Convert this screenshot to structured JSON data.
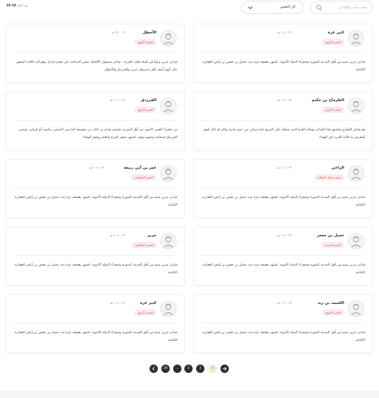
{
  "toolbar": {
    "search_placeholder": "ابحث باسم الشاعر...",
    "filter_value": "كل العصور",
    "count_prefix": "من أصل",
    "count_shown": "10",
    "count_total": "18"
  },
  "cards": [
    {
      "name": "كثير عزة",
      "dates": "٢٣ - ١٠٥ هـ",
      "era": "العصر الأموي",
      "avatar": "poet-portrait-icon",
      "bio": "شاعر عربي متيم من أهل المدينة المنورة وشعراء الدولة الأموية، اشتهر بعشقه عزة بنت جميل بن حفص بن إياس الغفارية الكنانية."
    },
    {
      "name": "الأخطل",
      "dates": "١٩ - ٩٢ هـ",
      "era": "العصر الأموي",
      "avatar": "poet-portrait-icon",
      "bio": "شاعر عربي ونشأ في قبيلة تغلب العربية ، شاعر مصقول الألفاظ، حسن الديباجة، في شعره إبداع. وهو أحد الثلاثة المتفق على أنهم أشعر أهل عصرهم: جرير والفرزدق والأخطل."
    },
    {
      "name": "الطرماح بن حكيم",
      "dates": "٢٣ - ١٠٥ هـ",
      "era": "العصر الأموي",
      "avatar": "poet-portrait-icon",
      "bio": "هو شاعر الخوارج واشتهر هذا الشاعر بهجائه الفذع الذي سلطه على المربع عامة وعلى بني تميم خاصة وكان قد قال فيهم أشعرش ما قالته العرب في الهجاء"
    },
    {
      "name": "الفرزدق",
      "dates": "٢٣ - ١٠٥ هـ",
      "era": "العصر الأموي",
      "avatar": "poet-portrait-icon",
      "bio": "من شعراء العصر الأموي من أهل البصرة، واسمه همام بن غالب بن صعصعة الدارمي التميمي، وكنيته أبو فراس، وسمي الفرزدق لضخامة وتجهم وجهه، اشتهر بشعر المدح والفخر وشعر الهجاء"
    },
    {
      "name": "الراعي",
      "dates": "٢٣ - ١٠٥ هـ",
      "era": "عصر ما قبل الإسلام",
      "avatar": "poet-portrait-icon",
      "bio": "شاعر عربي متيم من أهل المدينة المنورة وشعراء الدولة الأموية، اشتهر بعشقه عزة بنت جميل بن حفص بن إياس الغفارية الكنانية."
    },
    {
      "name": "عمر بن أبي ربيعة",
      "dates": "٢٣ - ١٠٥ هـ",
      "era": "العصر المملوكي",
      "avatar": "poet-portrait-icon",
      "bio": "شاعر عربي متيم من أهل المدينة المنورة وشعراء الدولة الأموية، اشتهر بعشقه عزة بنت جميل بن حفص بن إياس الغفارية الكنانية."
    },
    {
      "name": "جميل بن معمر",
      "dates": "٢٣ - ١٠٥ هـ",
      "era": "العصر الحديث",
      "avatar": "poet-portrait-icon",
      "bio": "شاعر عربي متيم من أهل المدينة المنورة وشعراء الدولة الأموية، اشتهر بعشقه عزة بنت جميل بن حفص بن إياس الغفارية الكنانية."
    },
    {
      "name": "جرير",
      "dates": "٢٣ - ١٠٥ هـ",
      "era": "العصر الإسلامي",
      "avatar": "poet-portrait-icon",
      "bio": "شاعر عربي متيم من أهل المدينة المنورة وشعراء الدولة الأموية، اشتهر بعشقه عزة بنت جميل بن حفص بن إياس الغفارية الكنانية."
    },
    {
      "name": "الكميت بن زيد",
      "dates": "٢٣ - ١٠٥ هـ",
      "era": "العصر الأموي",
      "avatar": "poet-portrait-icon",
      "bio": "شاعر عربي متيم من أهل المدينة المنورة وشعراء الدولة الأموية، اشتهر بعشقه عزة بنت جميل بن حفص بن إياس الغفارية الكنانية."
    },
    {
      "name": "كثير عزة",
      "dates": "٢٣ - ١٠٥ هـ",
      "era": "العصر الأموي",
      "avatar": "poet-portrait-icon",
      "bio": "شاعر عربي متيم من أهل المدينة المنورة وشعراء الدولة الأموية، اشتهر بعشقه عزة بنت جميل بن حفص بن إياس الغفارية الكنانية."
    }
  ],
  "pagination": {
    "next_icon": "arrow-right-icon",
    "prev_icon": "arrow-left-icon",
    "pages": [
      "1",
      "2",
      "3"
    ],
    "ellipsis": "...",
    "last_page": "20",
    "active_page": "1"
  },
  "colors": {
    "era_badge_bg": "#fbeaea",
    "era_badge_text": "#d04a4a",
    "active_page_bg": "#f3ead0",
    "page_button_bg": "#2c2f36"
  }
}
